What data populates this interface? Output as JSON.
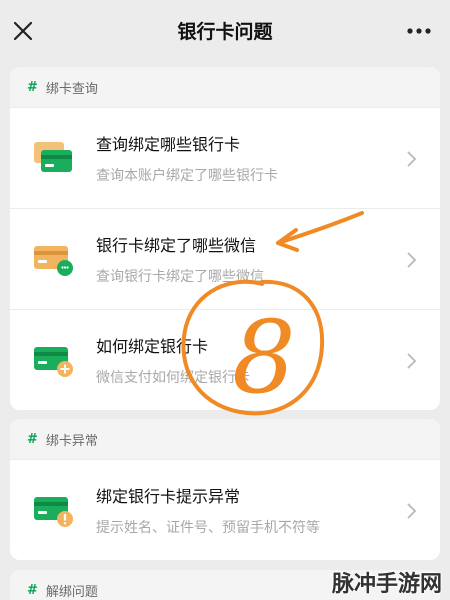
{
  "header": {
    "title": "银行卡问题"
  },
  "sections": [
    {
      "title": "绑卡查询",
      "items": [
        {
          "title": "查询绑定哪些银行卡",
          "subtitle": "查询本账户绑定了哪些银行卡",
          "icon": "green-cards-icon"
        },
        {
          "title": "银行卡绑定了哪些微信",
          "subtitle": "查询银行卡绑定了哪些微信",
          "icon": "card-wechat-icon"
        },
        {
          "title": "如何绑定银行卡",
          "subtitle": "微信支付如何绑定银行卡",
          "icon": "card-plus-icon"
        }
      ]
    },
    {
      "title": "绑卡异常",
      "items": [
        {
          "title": "绑定银行卡提示异常",
          "subtitle": "提示姓名、证件号、预留手机不符等",
          "icon": "card-warning-icon"
        }
      ]
    },
    {
      "title": "解绑问题"
    }
  ],
  "annotation": {
    "handwritten_mark": "8"
  },
  "watermark": "脉冲手游网",
  "colors": {
    "accent": "#07a557",
    "annotation": "#f08a24",
    "card_yellow": "#f2b45e"
  }
}
